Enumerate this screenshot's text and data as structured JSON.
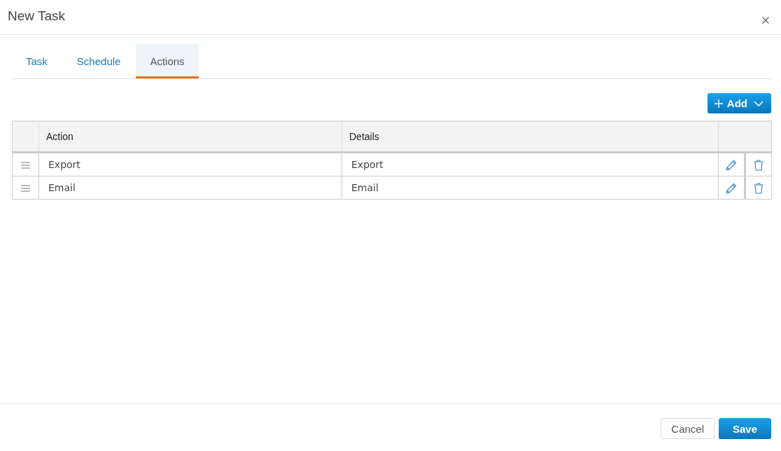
{
  "dialog": {
    "title": "New Task"
  },
  "tabs": [
    {
      "label": "Task",
      "selected": false
    },
    {
      "label": "Schedule",
      "selected": false
    },
    {
      "label": "Actions",
      "selected": true
    }
  ],
  "toolbar": {
    "add_button": {
      "label": "Add"
    }
  },
  "table": {
    "columns": [
      "Action",
      "Details"
    ],
    "rows": [
      {
        "action": "Export",
        "details": "Export"
      },
      {
        "action": "Email",
        "details": "Email"
      }
    ]
  },
  "footer": {
    "buttons": [
      {
        "label": "Cancel",
        "kind": "secondary"
      },
      {
        "label": "Save",
        "kind": "primary"
      }
    ]
  }
}
